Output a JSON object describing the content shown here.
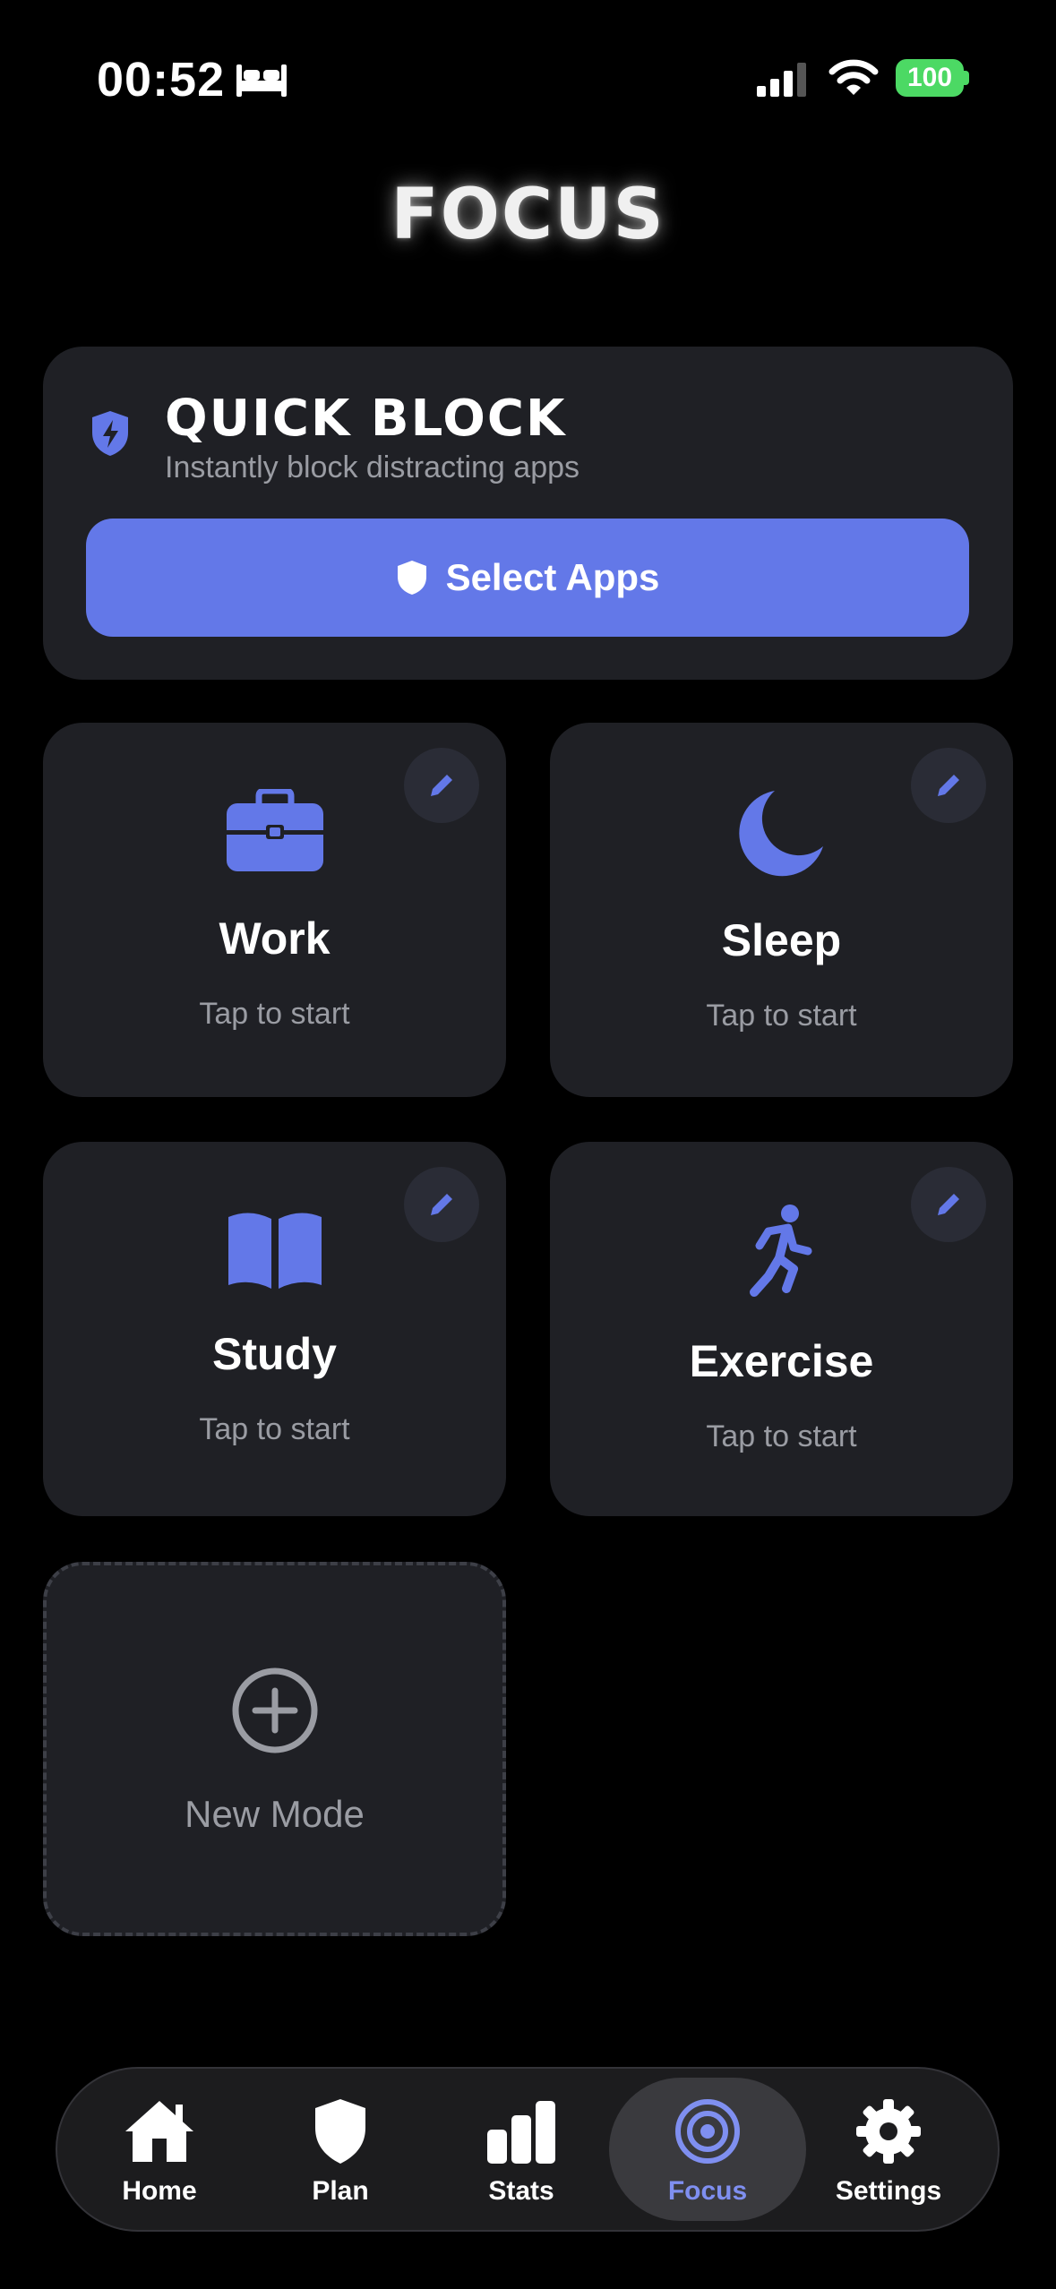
{
  "status_bar": {
    "time": "00:52",
    "battery": "100"
  },
  "page": {
    "title": "FOCUS"
  },
  "quick_block": {
    "title": "QUICK BLOCK",
    "subtitle": "Instantly block distracting apps",
    "button_label": "Select Apps"
  },
  "modes": [
    {
      "name": "Work",
      "subtitle": "Tap to start",
      "icon": "briefcase-icon"
    },
    {
      "name": "Sleep",
      "subtitle": "Tap to start",
      "icon": "moon-icon"
    },
    {
      "name": "Study",
      "subtitle": "Tap to start",
      "icon": "book-icon"
    },
    {
      "name": "Exercise",
      "subtitle": "Tap to start",
      "icon": "running-icon"
    }
  ],
  "new_mode": {
    "label": "New Mode"
  },
  "tab_bar": {
    "tabs": [
      {
        "label": "Home",
        "icon": "house-icon"
      },
      {
        "label": "Plan",
        "icon": "shield-icon"
      },
      {
        "label": "Stats",
        "icon": "bar-chart-icon"
      },
      {
        "label": "Focus",
        "icon": "target-icon",
        "active": true
      },
      {
        "label": "Settings",
        "icon": "gear-icon"
      }
    ]
  },
  "colors": {
    "accent": "#6378e8",
    "card": "#1f2025",
    "background": "#000000",
    "muted_text": "#9a9ca3",
    "battery": "#4cd964"
  }
}
